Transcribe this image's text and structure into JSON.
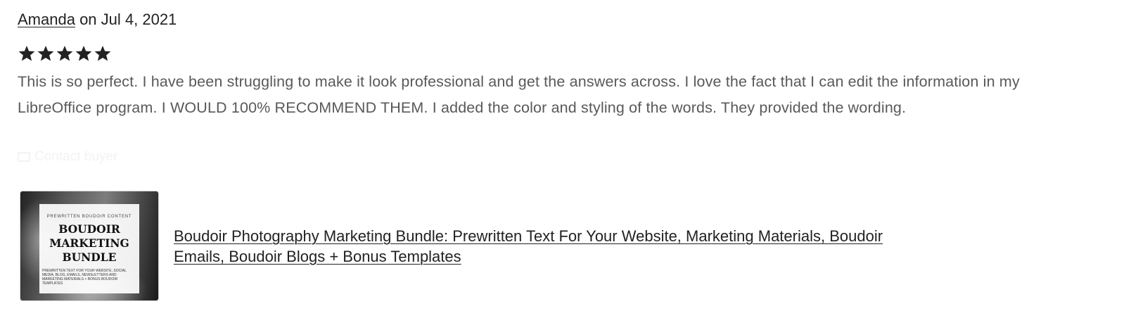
{
  "review": {
    "reviewer_name": "Amanda",
    "date_text": " on Jul 4, 2021",
    "rating": 5,
    "rating_max": 5,
    "star_color": "#222222",
    "text": "This is so perfect. I have been struggling to make it look professional and get the answers across. I love the fact that I can edit the information in my LibreOffice program. I WOULD 100% RECOMMEND THEM. I added the color and styling of the words. They provided the wording.",
    "contact_label": "Contact buyer"
  },
  "listing": {
    "title": "Boudoir Photography Marketing Bundle: Prewritten Text For Your Website, Marketing Materials, Boudoir Emails, Boudoir Blogs + Bonus Templates",
    "thumbnail": {
      "kicker": "PREWRITTEN BOUDOIR CONTENT",
      "headline_1": "BOUDOIR",
      "headline_2": "MARKETING",
      "headline_3": "BUNDLE",
      "subtext": "PREWRITTEN TEXT FOR YOUR WEBSITE, SOCIAL MEDIA, BLOG, EMAILS, NEWSLETTERS AND MARKETING MATERIALS + BONUS BOUDOIR TEMPLATES"
    }
  }
}
